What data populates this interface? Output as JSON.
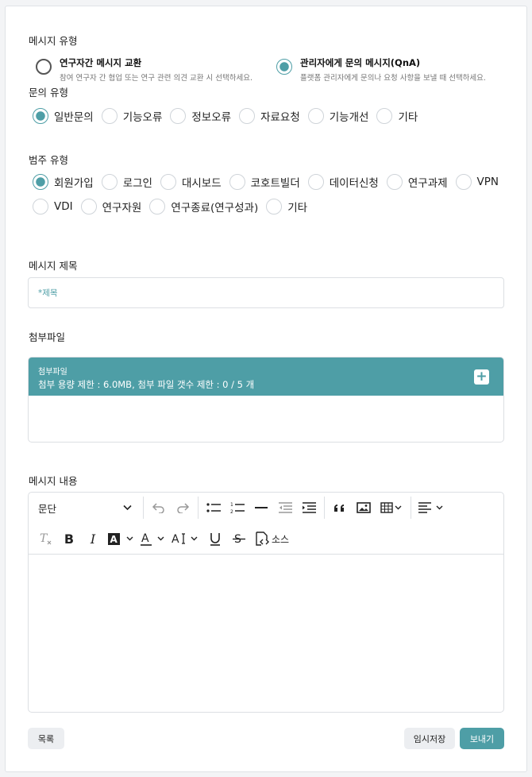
{
  "message_type": {
    "label": "메시지 유형",
    "options": [
      {
        "title": "연구자간 메시지 교환",
        "desc": "참여 연구자 간 협업 또는 연구 관련 의견 교환 시 선택하세요.",
        "selected": false
      },
      {
        "title": "관리자에게 문의 메시지(QnA)",
        "desc": "플랫폼 관리자에게 문의나 요청 사항을 보낼 때 선택하세요.",
        "selected": true
      }
    ]
  },
  "inquiry_type": {
    "label": "문의 유형",
    "options": [
      "일반문의",
      "기능오류",
      "정보오류",
      "자료요청",
      "기능개선",
      "기타"
    ],
    "selected": "일반문의"
  },
  "category_type": {
    "label": "범주 유형",
    "row1": [
      "회원가입",
      "로그인",
      "대시보드",
      "코호트빌더",
      "데이터신청",
      "연구과제",
      "VPN"
    ],
    "row2": [
      "VDI",
      "연구자원",
      "연구종료(연구성과)",
      "기타"
    ],
    "selected": "회원가입"
  },
  "subject": {
    "label": "메시지 제목",
    "placeholder": "*제목"
  },
  "attachments": {
    "label": "첨부파일",
    "header_title": "첨부파일",
    "limit_text": "첨부 용량 제한 : 6.0MB, 첨부 파일 갯수 제한 : 0 / 5 개"
  },
  "content": {
    "label": "메시지 내용",
    "block_format": "문단",
    "source_label": "소스"
  },
  "buttons": {
    "list": "목록",
    "draft": "임시저장",
    "send": "보내기"
  },
  "colors": {
    "accent": "#4e9ea6",
    "border": "#dcdfe3"
  }
}
